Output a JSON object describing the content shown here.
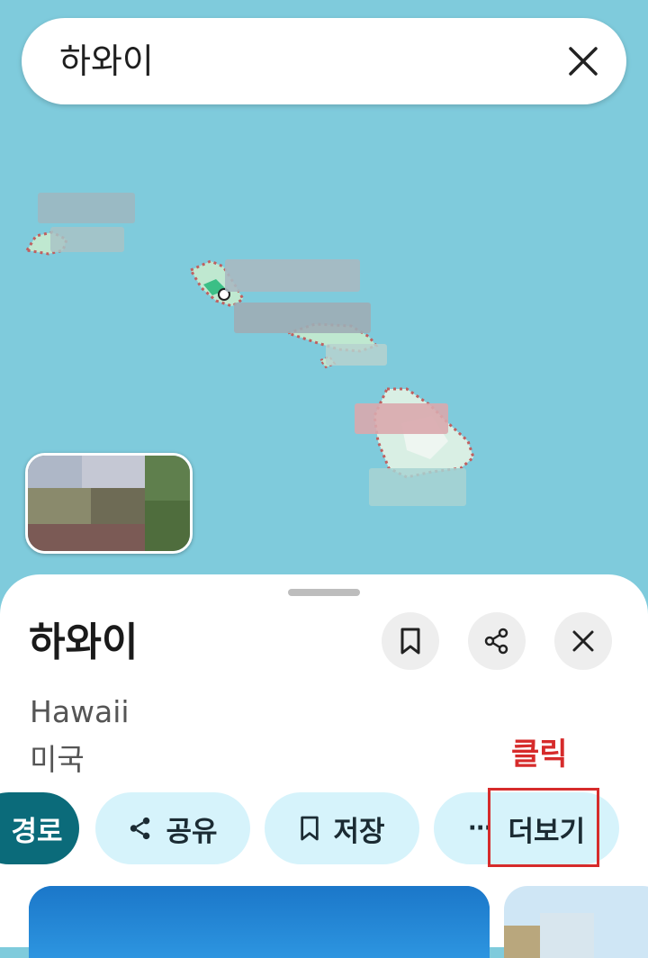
{
  "search": {
    "query": "하와이"
  },
  "map": {
    "islands": [
      {
        "name": "kauai-island"
      },
      {
        "name": "oahu-island"
      },
      {
        "name": "maui-island"
      },
      {
        "name": "big-island"
      }
    ]
  },
  "sheet": {
    "title": "하와이",
    "subtitle": "Hawaii",
    "country": "미국",
    "annotation": "클릭",
    "chips": {
      "directions": "경로",
      "share": "공유",
      "save": "저장",
      "more": "더보기"
    }
  },
  "colors": {
    "ocean": "#7fcbdc",
    "land": "#bfe8d0",
    "primary_chip": "#0b6b7a",
    "chip": "#d6f3fb",
    "annotation": "#d62b2b"
  }
}
